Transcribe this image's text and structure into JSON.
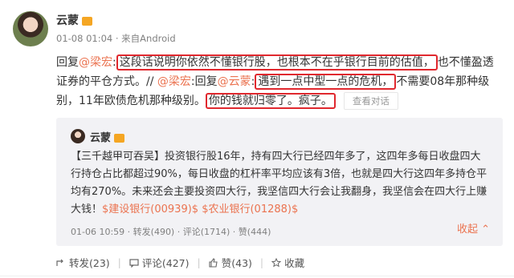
{
  "post": {
    "author": "云蒙",
    "meta": "01-08 01:04 · 来自Android",
    "segments": {
      "s1": "回复",
      "s2": "@梁宏",
      "s3": ":",
      "s4": "这段话说明你依然不懂银行股，也根本不在乎银行目前的估值，",
      "s5": "也不懂盈透证券的平仓方式。// ",
      "s6": "@梁宏",
      "s7": ":回复",
      "s8": "@云蒙",
      "s9": ":",
      "s10": "遇到一点中型一点的危机，",
      "s11": "不需要08年那种级别，11年欧债危机那种级别。",
      "s12": "你的钱就归零了。疯子。",
      "view_dialog": "查看对话"
    }
  },
  "repost": {
    "author": "云蒙",
    "text": "【三千越甲可吞吴】投资银行股16年，持有四大行已经四年多了，这四年多每日收盘四大行持仓占比都超过90%，每日收盘的杠杆率平均应该有3倍，也就是四大行这四年多持仓平均有270%。未来还会主要投资四大行，我坚信四大行会让我翻身，我坚信会在四大行上赚大钱！",
    "link1": "$建设银行(00939)$",
    "link2": "$农业银行(01288)$",
    "meta": "01-06 10:59 · 转发(490) · 评论(1714) · 赞(444)",
    "collapse": "收起 ⌃"
  },
  "actions": {
    "repost": "转发(23)",
    "comment": "评论(427)",
    "like": "赞(43)",
    "favorite": "收藏"
  },
  "colors": {
    "accent": "#eb7350",
    "highlight_box": "#e0282e"
  }
}
